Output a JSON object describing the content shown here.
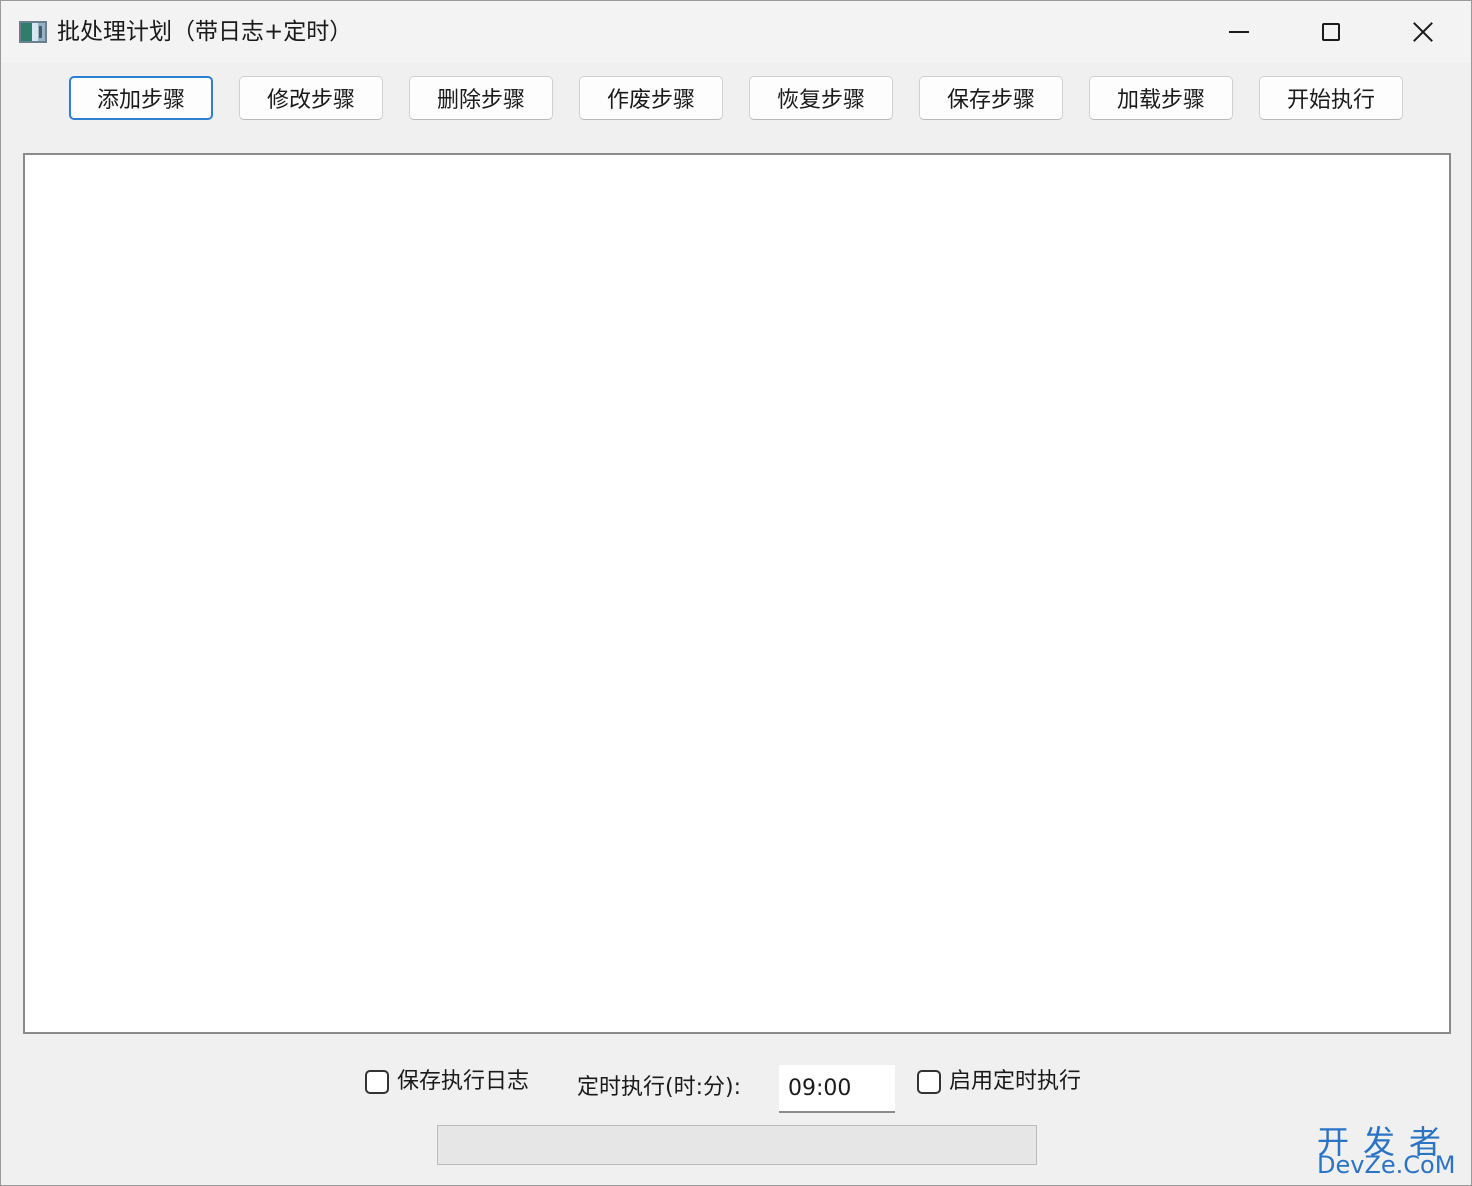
{
  "window": {
    "title": "批处理计划（带日志+定时）",
    "controls": {
      "minimize": "minimize-icon",
      "maximize": "maximize-icon",
      "close": "close-icon"
    }
  },
  "toolbar": {
    "buttons": [
      {
        "label": "添加步骤"
      },
      {
        "label": "修改步骤"
      },
      {
        "label": "删除步骤"
      },
      {
        "label": "作废步骤"
      },
      {
        "label": "恢复步骤"
      },
      {
        "label": "保存步骤"
      },
      {
        "label": "加载步骤"
      },
      {
        "label": "开始执行"
      }
    ]
  },
  "steps_list": {
    "items": []
  },
  "bottom": {
    "save_log": {
      "label": "保存执行日志",
      "checked": false
    },
    "schedule_label": "定时执行(时:分):",
    "schedule_time": "09:00",
    "enable_schedule": {
      "label": "启用定时执行",
      "checked": false
    },
    "progress": 0
  },
  "watermark": {
    "line1": "开发者",
    "line2": "DevZe.CoM"
  },
  "colors": {
    "accent": "#2f7fd0",
    "watermark": "#2b74c4"
  }
}
